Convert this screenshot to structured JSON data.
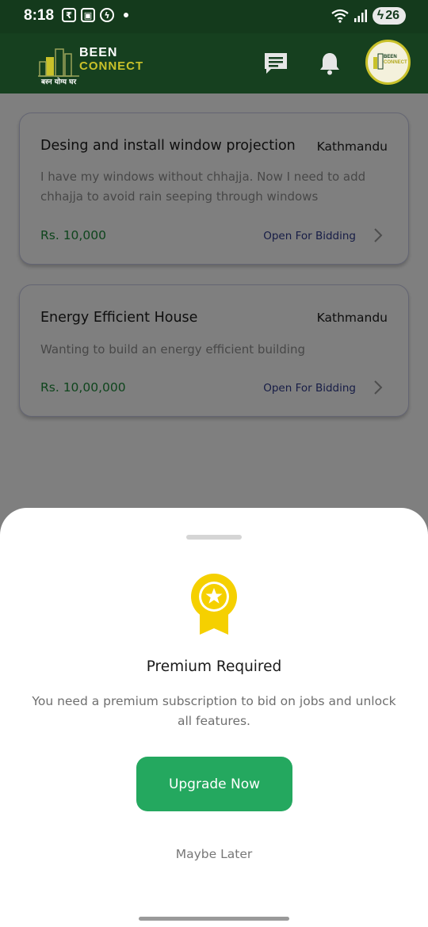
{
  "status_bar": {
    "time": "8:18",
    "battery": "26",
    "left_icons": [
      "rupee-icon",
      "screenshot-icon",
      "messenger-icon",
      "dot-icon"
    ],
    "right_icons": [
      "wifi-icon",
      "signal-icon",
      "battery-icon"
    ]
  },
  "header": {
    "logo_line1": "BEEN",
    "logo_line2": "CONNECT",
    "logo_tagline": "बस्न योग्य घर",
    "icons": [
      "chat-icon",
      "notification-bell-icon"
    ],
    "avatar_line1": "BEEN",
    "avatar_line2": "CONNECT",
    "brand_color": "#16401f",
    "accent_color": "#c9c12a"
  },
  "jobs": [
    {
      "title": "Desing and install window projection",
      "location": "Kathmandu",
      "description": "I have my windows without chhajja. Now I need to add chhajja to avoid rain seeping through windows",
      "price": "Rs. 10,000",
      "status": "Open For Bidding"
    },
    {
      "title": "Energy Efficient House",
      "location": "Kathmandu",
      "description": "Wanting to build an energy efficient building",
      "price": "Rs. 10,00,000",
      "status": "Open For Bidding"
    }
  ],
  "sheet": {
    "icon": "premium-medal-icon",
    "title": "Premium Required",
    "message": "You need a premium subscription to bid on jobs and unlock all features.",
    "primary_button": "Upgrade Now",
    "secondary_button": "Maybe Later",
    "primary_color": "#24a85f",
    "medal_color": "#f5d000"
  }
}
